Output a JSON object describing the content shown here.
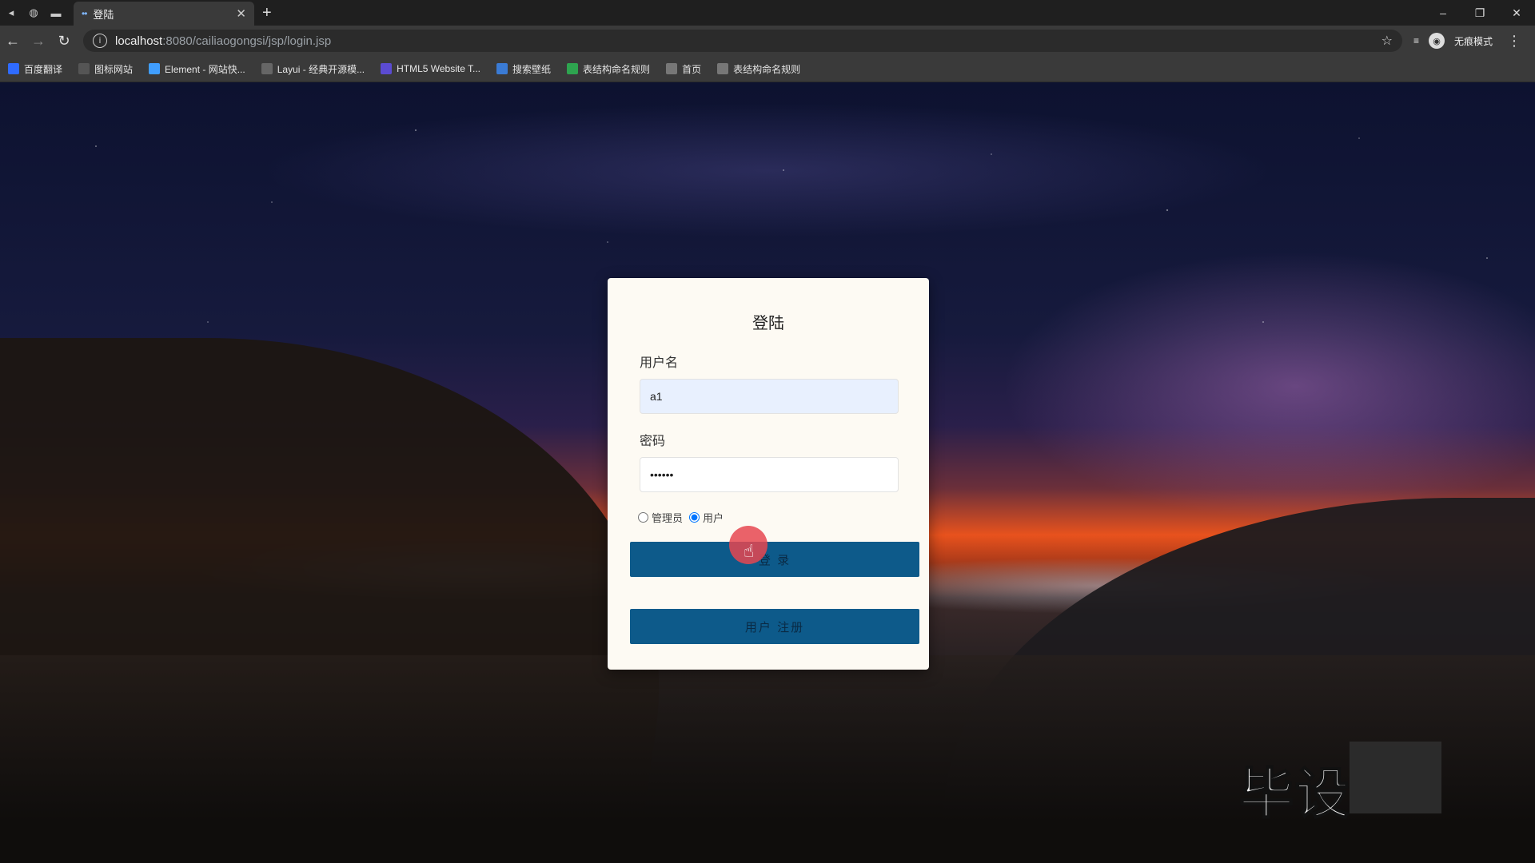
{
  "browser": {
    "tab_title": "登陆",
    "url_host": "localhost",
    "url_path": ":8080/cailiaogongsi/jsp/login.jsp",
    "profile_label": "无痕模式",
    "window_controls": [
      "–",
      "❐",
      "✕"
    ],
    "bookmarks": [
      {
        "label": "百度翻译",
        "icon": "translate-icon",
        "color": "#2f6bff"
      },
      {
        "label": "图标网站",
        "icon": "flag-icon",
        "color": "#555555"
      },
      {
        "label": "Element - 网站快...",
        "icon": "element-icon",
        "color": "#409eff"
      },
      {
        "label": "Layui - 经典开源模...",
        "icon": "layui-icon",
        "color": "#666666"
      },
      {
        "label": "HTML5 Website T...",
        "icon": "html5-icon",
        "color": "#5b4bd1"
      },
      {
        "label": "搜索壁纸",
        "icon": "wallpaper-icon",
        "color": "#3a7bd5"
      },
      {
        "label": "表结构命名规则",
        "icon": "doc-green-icon",
        "color": "#2ea44f"
      },
      {
        "label": "首页",
        "icon": "globe-icon",
        "color": "#777777"
      },
      {
        "label": "表结构命名规则",
        "icon": "globe-icon",
        "color": "#777777"
      }
    ]
  },
  "login": {
    "title": "登陆",
    "username_label": "用户名",
    "username_value": "a1",
    "password_label": "密码",
    "password_value": "••••••",
    "roles": [
      {
        "label": "管理员",
        "checked": false
      },
      {
        "label": "用户",
        "checked": true
      }
    ],
    "login_button": "登 录",
    "register_button": "用户 注册"
  },
  "watermark": "毕设"
}
